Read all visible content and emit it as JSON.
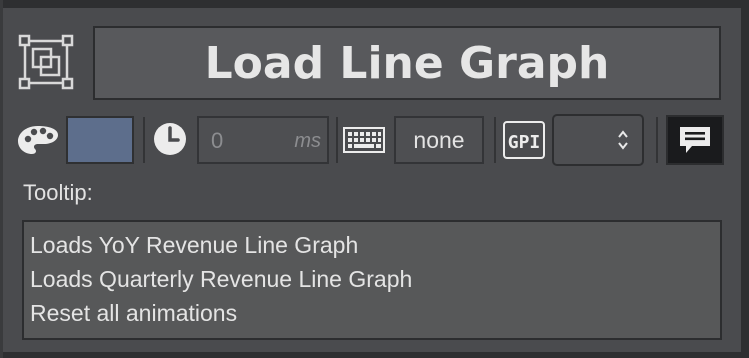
{
  "header": {
    "title": "Load Line Graph",
    "type_icon": "group-frame-icon"
  },
  "toolbar": {
    "color_icon": "palette-icon",
    "color_value": "#5d6e8c",
    "delay_icon": "clock-icon",
    "delay_value": "0",
    "delay_unit": "ms",
    "shortcut_icon": "keyboard-icon",
    "shortcut_value": "none",
    "gpi_icon": "gpi-icon",
    "gpi_value": "",
    "tooltip_toggle_icon": "comment-icon"
  },
  "tooltip": {
    "label": "Tooltip:",
    "lines": [
      "Loads YoY Revenue Line Graph",
      "Loads Quarterly Revenue Line Graph",
      "Reset all animations"
    ]
  },
  "colors": {
    "panel_bg": "#4a4b4e",
    "field_bg": "#4e4f52",
    "title_bg": "#58595c",
    "swatch": "#5d6e8c",
    "text": "#e4e4e4"
  }
}
